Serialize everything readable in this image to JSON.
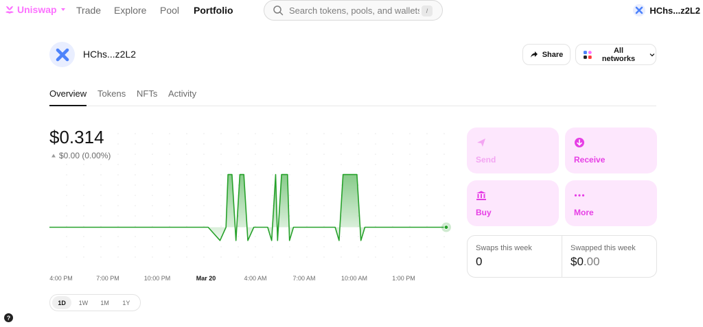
{
  "nav": {
    "brand": "Uniswap",
    "links": [
      "Trade",
      "Explore",
      "Pool",
      "Portfolio"
    ],
    "active": "Portfolio",
    "search_placeholder": "Search tokens, pools, and wallets",
    "search_shortcut": "/",
    "account_name": "HChs...z2L2"
  },
  "header": {
    "wallet_name": "HChs...z2L2",
    "share_label": "Share",
    "networks_label": "All networks"
  },
  "tabs": [
    "Overview",
    "Tokens",
    "NFTs",
    "Activity"
  ],
  "active_tab": "Overview",
  "balance": {
    "value": "$0.314",
    "change": "$0.00 (0.00%)"
  },
  "chart_data": {
    "type": "line",
    "x_ticks": [
      "4:00 PM",
      "7:00 PM",
      "10:00 PM",
      "Mar 20",
      "4:00 AM",
      "7:00 AM",
      "10:00 AM",
      "1:00 PM"
    ],
    "series": [
      {
        "points": [
          [
            0,
            0.314
          ],
          [
            0.4,
            0.314
          ],
          [
            0.43,
            0.31
          ],
          [
            0.445,
            0.314
          ],
          [
            0.45,
            0.33
          ],
          [
            0.46,
            0.33
          ],
          [
            0.47,
            0.31
          ],
          [
            0.48,
            0.33
          ],
          [
            0.49,
            0.33
          ],
          [
            0.5,
            0.31
          ],
          [
            0.515,
            0.314
          ],
          [
            0.55,
            0.314
          ],
          [
            0.56,
            0.31
          ],
          [
            0.57,
            0.33
          ],
          [
            0.575,
            0.31
          ],
          [
            0.585,
            0.33
          ],
          [
            0.6,
            0.33
          ],
          [
            0.605,
            0.31
          ],
          [
            0.615,
            0.314
          ],
          [
            0.72,
            0.314
          ],
          [
            0.73,
            0.31
          ],
          [
            0.74,
            0.33
          ],
          [
            0.775,
            0.33
          ],
          [
            0.785,
            0.31
          ],
          [
            0.795,
            0.314
          ],
          [
            1,
            0.314
          ]
        ]
      }
    ],
    "line_color": "#26a12a",
    "fill_color": "#26a12a"
  },
  "time_ranges": [
    "1D",
    "1W",
    "1M",
    "1Y"
  ],
  "active_range": "1D",
  "actions": [
    {
      "label": "Send",
      "icon": "send-icon"
    },
    {
      "label": "Receive",
      "icon": "receive-icon"
    },
    {
      "label": "Buy",
      "icon": "bank-icon"
    },
    {
      "label": "More",
      "icon": "more-icon"
    }
  ],
  "stats": {
    "swaps_label": "Swaps this week",
    "swaps_value": "0",
    "swapped_label": "Swapped this week",
    "swapped_value_main": "$0",
    "swapped_value_cents": ".00"
  },
  "help": "?",
  "colors": {
    "brand": "#fc72ff",
    "accent_pink": "#e63fe5",
    "action_bg": "#fde7fd",
    "chart_green": "#26a12a"
  }
}
